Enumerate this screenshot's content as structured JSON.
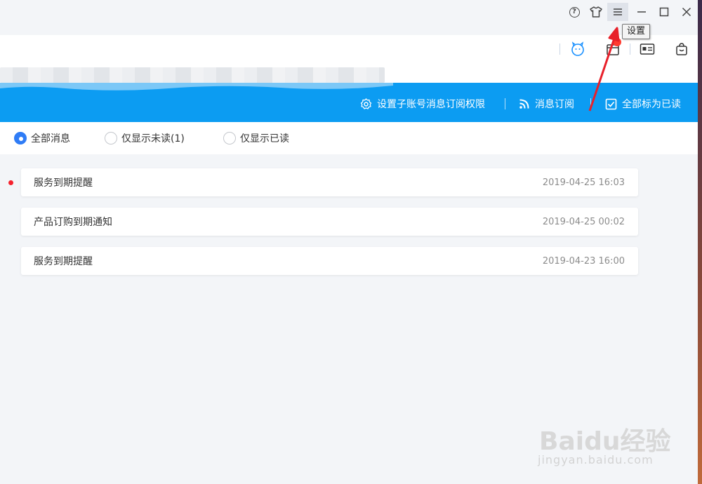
{
  "titlebar": {
    "tooltip": "设置"
  },
  "toolbar": {
    "subaccount_settings": "设置子账号消息订阅权限",
    "subscribe": "消息订阅",
    "mark_all_read": "全部标为已读"
  },
  "filters": [
    {
      "label": "全部消息",
      "checked": true
    },
    {
      "label": "仅显示未读(1)",
      "checked": false
    },
    {
      "label": "仅显示已读",
      "checked": false
    }
  ],
  "messages": [
    {
      "title": "服务到期提醒",
      "time": "2019-04-25 16:03",
      "unread": true
    },
    {
      "title": "产品订购到期通知",
      "time": "2019-04-25 00:02",
      "unread": false
    },
    {
      "title": "服务到期提醒",
      "time": "2019-04-23 16:00",
      "unread": false
    }
  ],
  "watermark": {
    "main": "Baidu经验",
    "sub": "jingyan.baidu.com"
  },
  "colors": {
    "accent_blue": "#0c9cf2",
    "radio_blue": "#2f7cf6",
    "unread_red": "#f5222d",
    "arrow_red": "#e8202a"
  }
}
